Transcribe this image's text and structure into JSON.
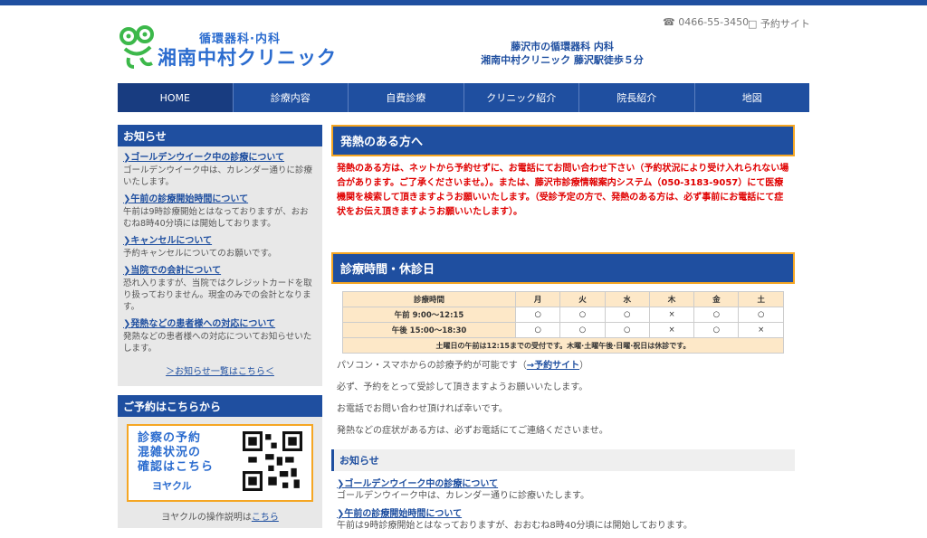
{
  "header": {
    "logo_sub": "循環器科·内科",
    "logo_name": "湘南中村クリニック",
    "phone": "0466-55-3450",
    "reserve_link": "予約サイト",
    "tagline_line1": "藤沢市の循環器科 内科",
    "tagline_line2": "湘南中村クリニック 藤沢駅徒歩５分"
  },
  "nav": {
    "items": [
      "HOME",
      "診療内容",
      "自費診療",
      "クリニック紹介",
      "院長紹介",
      "地図"
    ]
  },
  "sidebar": {
    "news_title": "お知らせ",
    "news": [
      {
        "title": "ゴールデンウイーク中の診療について",
        "text": "ゴールデンウイーク中は、カレンダー通りに診療いたします。"
      },
      {
        "title": "午前の診療開始時間について",
        "text": "午前は9時診療開始とはなっておりますが、おおむね8時40分頃には開始しております。"
      },
      {
        "title": "キャンセルについて",
        "text": "予約キャンセルについてのお願いです。"
      },
      {
        "title": "当院での会計について",
        "text": "恐れ入りますが、当院ではクレジットカードを取り扱っておりません。現金のみでの会計となります。"
      },
      {
        "title": "発熱などの患者様への対応について",
        "text": "発熱などの患者様への対応についてお知らせいたします。"
      }
    ],
    "news_more": "＞お知らせ一覧はこちら＜",
    "reserve_title": "ご予約はこちらから",
    "banner_line1": "診察の予約",
    "banner_line2": "混雑状況の",
    "banner_line3": "確認はこちら",
    "banner_brand": "ヨヤクル",
    "yakuru_note_prefix": "ヨヤクルの操作説明は",
    "yakuru_note_link": "こちら"
  },
  "main": {
    "fever_title": "発熱のある方へ",
    "fever_text": "発熱のある方は、ネットから予約せずに、お電話にてお問い合わせ下さい（予約状況により受け入れられない場合があります。ご了承くださいませ。）。または、藤沢市診療情報案内システム（050-3183-9057）にて医療機関を検索して頂きますようお願いいたします。（受診予定の方で、発熱のある方は、必ず事前にお電話にて症状をお伝え頂きますようお願いいたします）。",
    "hours_title": "診療時間・休診日",
    "schedule": {
      "header_label": "診療時間",
      "days": [
        "月",
        "火",
        "水",
        "木",
        "金",
        "土"
      ],
      "rows": [
        {
          "label": "午前 9:00〜12:15",
          "marks": [
            "○",
            "○",
            "○",
            "×",
            "○",
            "○"
          ]
        },
        {
          "label": "午後 15:00〜18:30",
          "marks": [
            "○",
            "○",
            "○",
            "×",
            "○",
            "×"
          ]
        }
      ],
      "note": "土曜日の午前は12:15までの受付です。木曜·土曜午後·日曜·祝日は休診です。"
    },
    "p1_prefix": "パソコン・スマホからの診療予約が可能です（",
    "p1_link": "→予約サイト",
    "p1_suffix": "）",
    "p2": "必ず、予約をとって受診して頂きますようお願いいたします。",
    "p3": "お電話でお問い合わせ頂ければ幸いです。",
    "p4": "発熱などの症状がある方は、必ずお電話にてご連絡くださいませ。",
    "news_title": "お知らせ",
    "news": [
      {
        "title": "ゴールデンウイーク中の診療について",
        "text": "ゴールデンウイーク中は、カレンダー通りに診療いたします。"
      },
      {
        "title": "午前の診療開始時間について",
        "text": "午前は9時診療開始とはなっておりますが、おおむね8時40分頃には開始しております。"
      }
    ]
  },
  "colors": {
    "brand": "#1f4fa0",
    "accent": "#f5a623",
    "warning": "#e00000",
    "logo": "#2b6ccf"
  }
}
